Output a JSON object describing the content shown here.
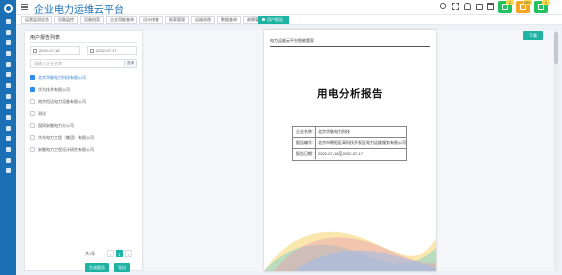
{
  "app": {
    "title": "企业电力运维云平台"
  },
  "header_tools": [
    "search-icon",
    "fullscreen-icon",
    "bell-icon",
    "lock-icon",
    "trash-icon"
  ],
  "header_badges": [
    {
      "icon": "alarm-icon",
      "count": "1",
      "color": "#22c35e"
    },
    {
      "icon": "warning-icon",
      "count": "99+",
      "color": "#f5a623"
    },
    {
      "icon": "message-icon",
      "count": "1",
      "color": "#22c35e"
    }
  ],
  "tabs": [
    {
      "label": "运营监测总览"
    },
    {
      "label": "设备监控"
    },
    {
      "label": "设备档案"
    },
    {
      "label": "企业用能查询"
    },
    {
      "label": "设计排查"
    },
    {
      "label": "报表管理"
    },
    {
      "label": "运维巡视"
    },
    {
      "label": "数据查询"
    },
    {
      "label": "故障管理"
    },
    {
      "label": "用户报告",
      "active": true
    }
  ],
  "left_panel": {
    "title": "用户报告列表",
    "start_date": "2022-07-18",
    "end_date": "2022-07-17",
    "search_placeholder": "请输入企业名称",
    "search_button": "查询",
    "items": [
      {
        "label": "北京华能电力科技有限公司",
        "checked": true,
        "highlight": true
      },
      {
        "label": "华为技术有限公司",
        "checked": true,
        "highlight": false
      },
      {
        "label": "南京恒达电力设备有限公司",
        "checked": false,
        "highlight": false
      },
      {
        "label": "测试",
        "checked": false,
        "highlight": false
      },
      {
        "label": "国网安徽电力分公司",
        "checked": false,
        "highlight": false
      },
      {
        "label": "华东电力工程（集团）有限公司",
        "checked": false,
        "highlight": false
      },
      {
        "label": "安徽电力工程设计研究有限公司",
        "checked": false,
        "highlight": false
      }
    ],
    "pager": {
      "total": "共1条",
      "current": "1"
    },
    "buttons": {
      "generate": "生成报告",
      "export": "导出"
    }
  },
  "report": {
    "header": "电力运维云平台智能管家",
    "title": "用电分析报告",
    "fields": [
      {
        "key": "企业名称：",
        "value": "北京华能电力科技"
      },
      {
        "key": "报告编号：",
        "value": "北京市朝阳区高科技开发区电力运维服务有限公司"
      },
      {
        "key": "报告日期：",
        "value": "2022-07-18至2022-07-17"
      }
    ]
  },
  "export_button": "下载"
}
